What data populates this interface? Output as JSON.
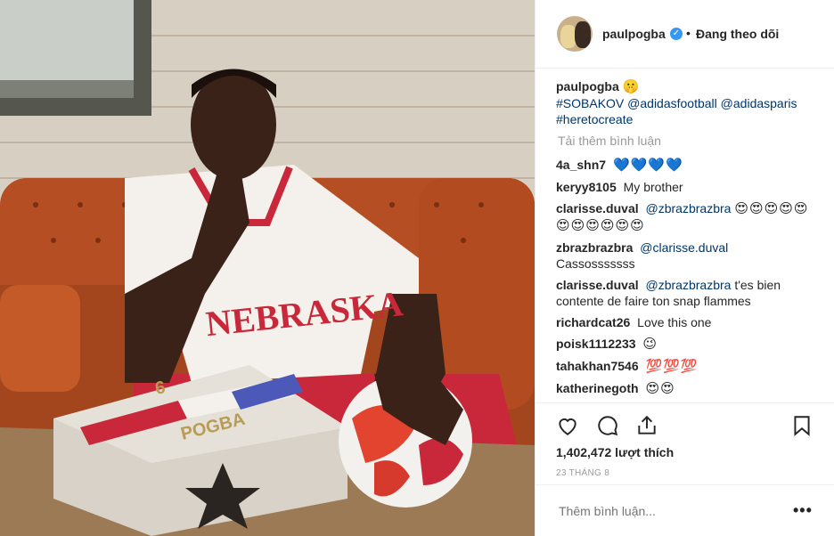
{
  "post": {
    "header": {
      "username": "paulpogba",
      "separator": "•",
      "follow_status": "Đang theo dõi",
      "verified_icon": "verified-badge-icon"
    },
    "caption": {
      "username": "paulpogba",
      "emoji": "🤫",
      "line1_tag": "#SOBAKOV",
      "mention1": "@adidasfootball",
      "mention2": "@adidasparis",
      "line2_tag": "#heretocreate"
    },
    "load_more": "Tải thêm bình luận",
    "comments": [
      {
        "user": "4a_shn7",
        "text": "💙💙💙💙"
      },
      {
        "user": "keryy8105",
        "text": "My brother"
      },
      {
        "user": "clarisse.duval",
        "mention": "@zbrazbrazbra",
        "text": "😍😍😍😍😍😍😍😍😍😍😍"
      },
      {
        "user": "zbrazbrazbra",
        "mention": "@clarisse.duval",
        "text": "Cassosssssss"
      },
      {
        "user": "clarisse.duval",
        "mention": "@zbrazbrazbra",
        "text": "t'es bien contente de faire ton snap flammes"
      },
      {
        "user": "richardcat26",
        "text": "Love this one"
      },
      {
        "user": "poisk1112233",
        "text": "😉"
      },
      {
        "user": "tahakhan7546",
        "text": "💯💯💯"
      },
      {
        "user": "katherinegoth",
        "text": "😍😍"
      }
    ],
    "likes": "1,402,472 lượt thích",
    "date": "23 THÁNG 8",
    "add_comment_placeholder": "Thêm bình luận...",
    "more_label": "•••",
    "photo_text": {
      "shirt": "NEBRASKA",
      "box": "POGBA",
      "box_number": "6"
    }
  }
}
